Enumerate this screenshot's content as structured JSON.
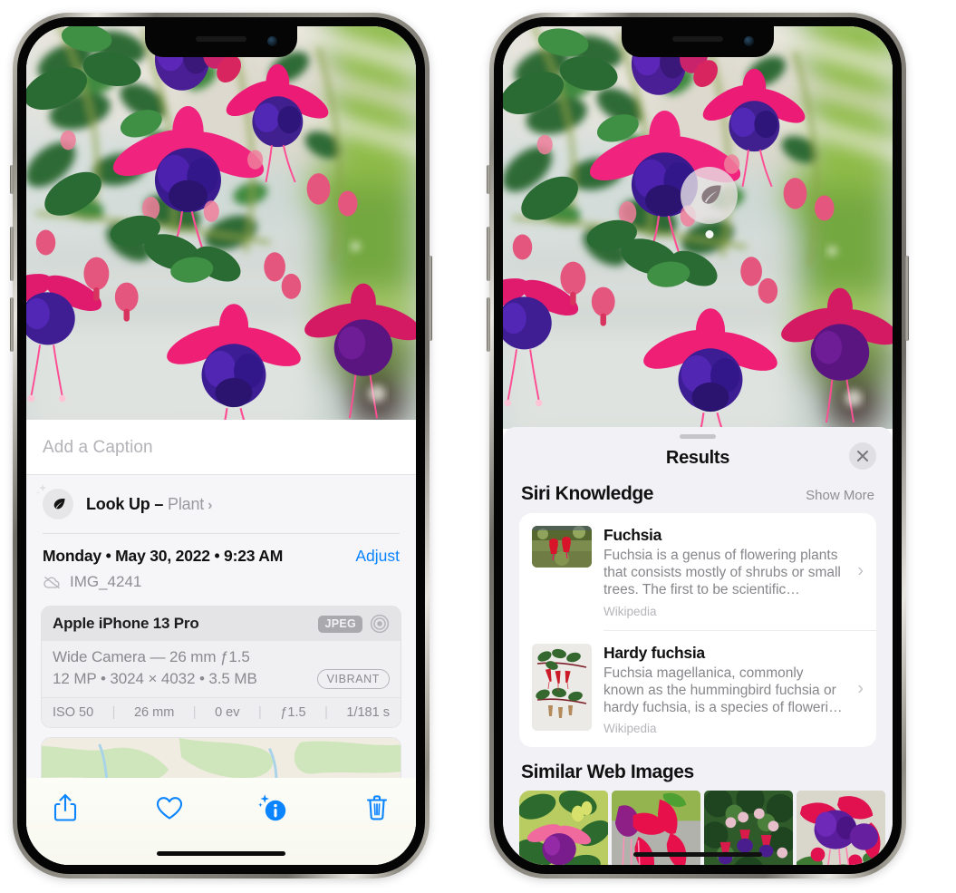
{
  "left_phone": {
    "name": "photos-detail-screen",
    "photo_alt": "fuchsia-flowers-photo",
    "caption_field": {
      "placeholder": "Add a Caption",
      "value": ""
    },
    "look_up": {
      "label": "Look Up",
      "dash": "–",
      "kind": "Plant",
      "chevron": "›",
      "icon": "leaf-icon"
    },
    "date_line": {
      "text": "Monday • May 30, 2022 • 9:23 AM",
      "adjust_label": "Adjust"
    },
    "file_line": {
      "icon": "cloud-slash-icon",
      "name": "IMG_4241"
    },
    "exif": {
      "device": "Apple iPhone 13 Pro",
      "format_badge": "JPEG",
      "aperture_icon": "aperture-icon",
      "lens_line": "Wide Camera — 26 mm ƒ1.5",
      "size_line": "12 MP • 3024 × 4032 • 3.5 MB",
      "style_badge": "VIBRANT",
      "stats": [
        "ISO 50",
        "26 mm",
        "0 ev",
        "ƒ1.5",
        "1/181 s"
      ],
      "stat_separator": "|"
    },
    "map": {
      "name": "location-map-thumbnail",
      "pin": "photo-pin-thumbnail"
    },
    "toolbar": [
      {
        "name": "share-button",
        "icon": "share-icon"
      },
      {
        "name": "favorite-button",
        "icon": "heart-icon"
      },
      {
        "name": "info-button",
        "icon": "info-sparkle-icon",
        "active": true
      },
      {
        "name": "delete-button",
        "icon": "trash-icon"
      }
    ]
  },
  "right_phone": {
    "name": "visual-look-up-results-screen",
    "photo_alt": "fuchsia-flowers-photo",
    "lookup_bubble": {
      "icon": "leaf-icon",
      "name": "visual-look-up-badge"
    },
    "sheet": {
      "title": "Results",
      "close_icon": "close-icon",
      "sections": [
        {
          "title": "Siri Knowledge",
          "action_label": "Show More",
          "items": [
            {
              "title": "Fuchsia",
              "description": "Fuchsia is a genus of flowering plants that consists mostly of shrubs or small trees. The first to be scientific…",
              "source": "Wikipedia",
              "thumb": "fuchsia-red-flowers-thumbnail",
              "chevron": "›"
            },
            {
              "title": "Hardy fuchsia",
              "description": "Fuchsia magellanica, commonly known as the hummingbird fuchsia or hardy fuchsia, is a species of floweri…",
              "source": "Wikipedia",
              "thumb": "hardy-fuchsia-specimen-thumbnail",
              "chevron": "›"
            }
          ]
        },
        {
          "title": "Similar Web Images",
          "items": [
            {
              "thumb": "web-image-1-pink-purple-fuchsia"
            },
            {
              "thumb": "web-image-2-red-fuchsia-closeup"
            },
            {
              "thumb": "web-image-3-fuchsia-bush"
            },
            {
              "thumb": "web-image-4-purple-pink-fuchsia"
            }
          ]
        }
      ]
    }
  },
  "colors": {
    "accent_blue": "#0a84ff",
    "sheet_bg": "#f2f1f6",
    "card_bg": "#ffffff",
    "secondary_text": "#8e8e93",
    "primary_text": "#111111"
  }
}
